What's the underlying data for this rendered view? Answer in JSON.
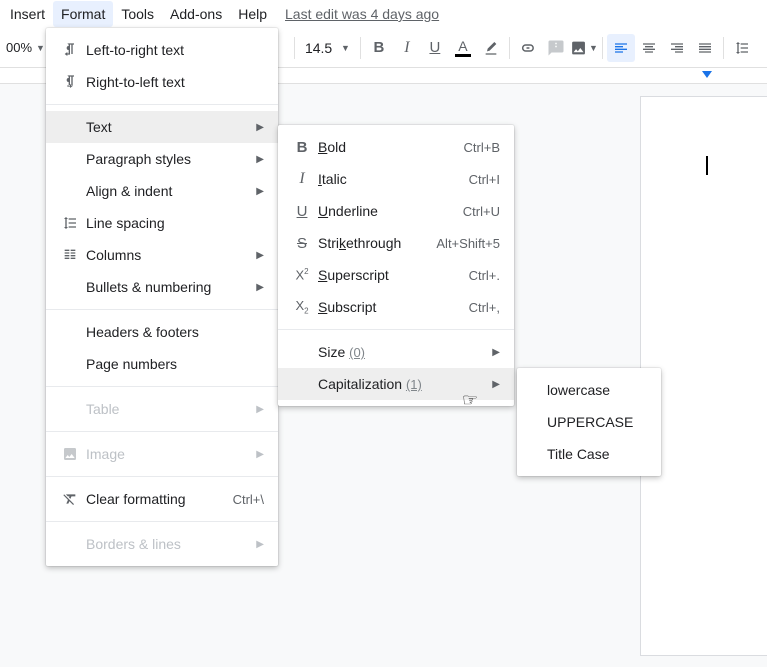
{
  "menubar": {
    "items": [
      "Insert",
      "Format",
      "Tools",
      "Add-ons",
      "Help"
    ],
    "last_edit": "Last edit was 4 days ago"
  },
  "toolbar": {
    "zoom": "00%",
    "font_size": "14.5"
  },
  "format_menu": {
    "ltr": "Left-to-right text",
    "rtl": "Right-to-left text",
    "text": "Text",
    "para": "Paragraph styles",
    "align": "Align & indent",
    "spacing": "Line spacing",
    "columns": "Columns",
    "bullets": "Bullets & numbering",
    "headers": "Headers & footers",
    "pagenum": "Page numbers",
    "table": "Table",
    "image": "Image",
    "clearfmt": "Clear formatting",
    "clearfmt_sc": "Ctrl+\\",
    "borders": "Borders & lines"
  },
  "text_menu": {
    "bold": "old",
    "bold_pre": "B",
    "bold_sc": "Ctrl+B",
    "italic": "talic",
    "italic_pre": "I",
    "italic_sc": "Ctrl+I",
    "underline": "nderline",
    "underline_pre": "U",
    "underline_sc": "Ctrl+U",
    "strike_pre": "Stri",
    "strike_mid": "k",
    "strike_post": "ethrough",
    "strike_sc": "Alt+Shift+5",
    "super": "uperscript",
    "super_pre": "S",
    "super_sc": "Ctrl+.",
    "sub": "ubscript",
    "sub_pre": "S",
    "sub_sc": "Ctrl+,",
    "size": "Size ",
    "size_hint": "(0)",
    "cap": "Capitalization ",
    "cap_hint": "(1)"
  },
  "cap_menu": {
    "lower": "lowercase",
    "upper": "UPPERCASE",
    "title": "Title Case"
  }
}
